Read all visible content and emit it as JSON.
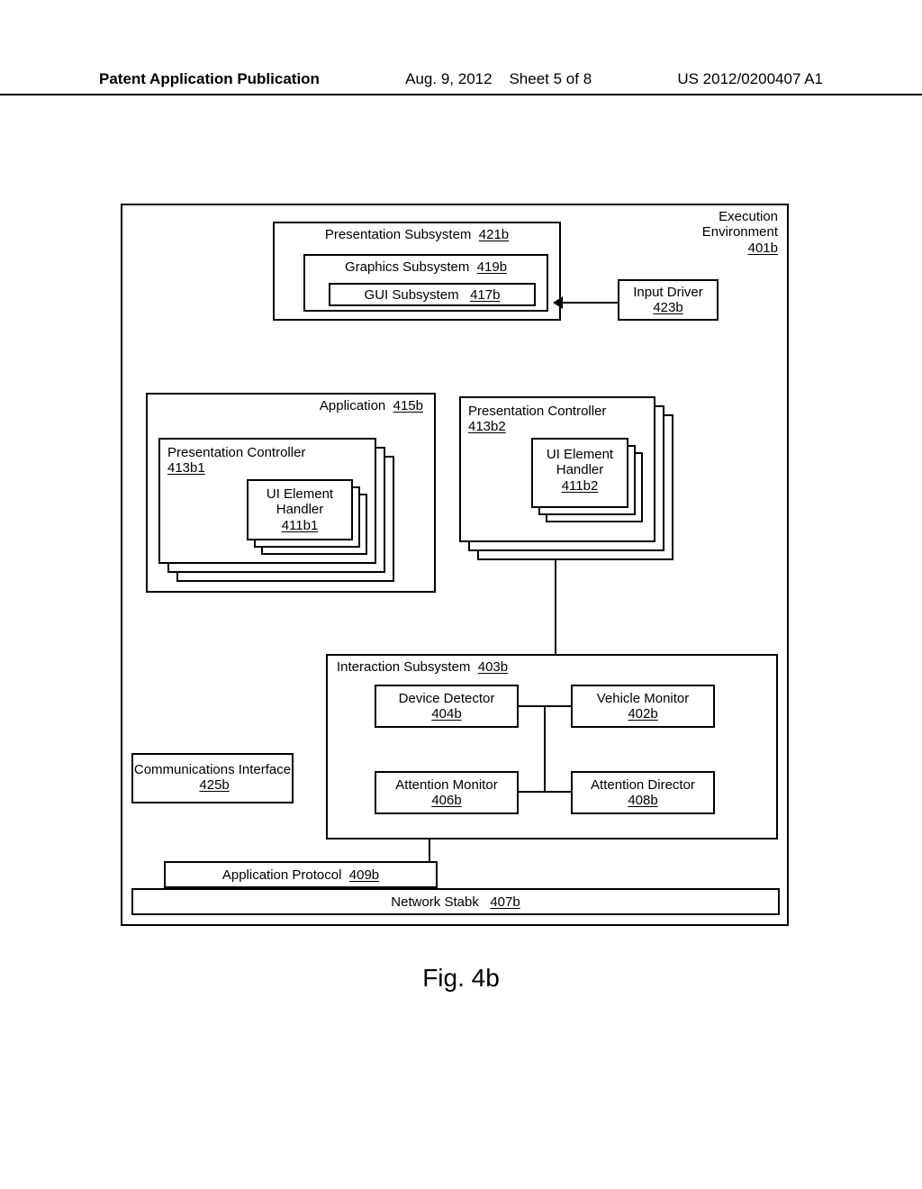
{
  "header": {
    "left": "Patent Application Publication",
    "mid_date": "Aug. 9, 2012",
    "mid_sheet": "Sheet 5 of 8",
    "right": "US 2012/0200407 A1"
  },
  "exec_env": {
    "title": "Execution Environment",
    "ref": "401b"
  },
  "pres_sub": {
    "title": "Presentation Subsystem",
    "ref": "421b"
  },
  "gfx_sub": {
    "title": "Graphics Subsystem",
    "ref": "419b"
  },
  "gui_sub": {
    "title": "GUI Subsystem",
    "ref": "417b"
  },
  "input_drv": {
    "title": "Input Driver",
    "ref": "423b"
  },
  "application": {
    "title": "Application",
    "ref": "415b"
  },
  "pc1": {
    "title": "Presentation Controller",
    "ref": "413b1"
  },
  "ueh1": {
    "title": "UI Element Handler",
    "ref": "411b1"
  },
  "pc2": {
    "title": "Presentation Controller",
    "ref": "413b2"
  },
  "ueh2": {
    "title": "UI Element Handler",
    "ref": "411b2"
  },
  "interaction": {
    "title": "Interaction Subsystem",
    "ref": "403b"
  },
  "dev_detect": {
    "title": "Device Detector",
    "ref": "404b"
  },
  "veh_mon": {
    "title": "Vehicle Monitor",
    "ref": "402b"
  },
  "att_mon": {
    "title": "Attention Monitor",
    "ref": "406b"
  },
  "att_dir": {
    "title": "Attention Director",
    "ref": "408b"
  },
  "comm_if": {
    "title": "Communications Interface",
    "ref": "425b"
  },
  "app_proto": {
    "title": "Application Protocol",
    "ref": "409b"
  },
  "net_stack": {
    "title": "Network Stabk",
    "ref": "407b"
  },
  "figure_label": "Fig. 4b"
}
